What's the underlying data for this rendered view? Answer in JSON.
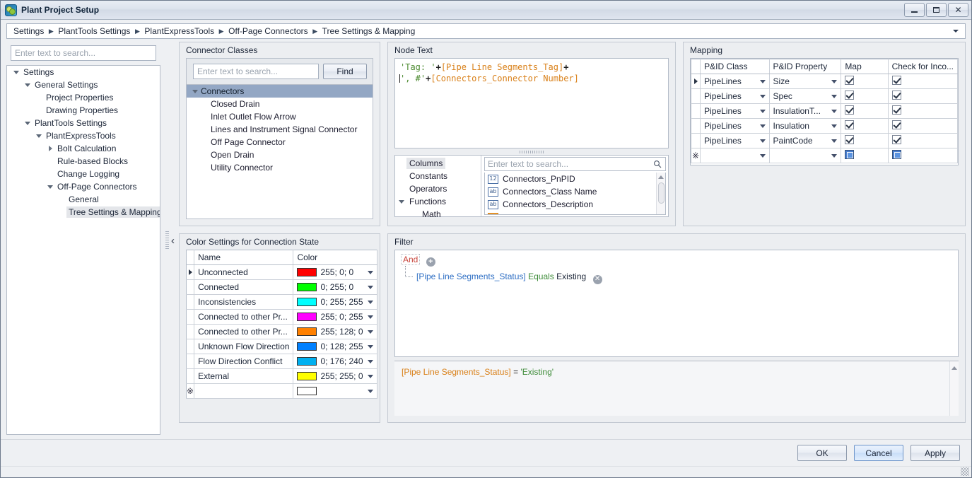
{
  "window": {
    "title": "Plant Project Setup",
    "app_icon": "plant-app-icon",
    "minimize_label": "Minimize",
    "maximize_label": "Maximize",
    "close_label": "Close"
  },
  "breadcrumb": {
    "items": [
      "Settings",
      "PlantTools Settings",
      "PlantExpressTools",
      "Off-Page Connectors",
      "Tree Settings & Mapping"
    ],
    "separator": "▶"
  },
  "sidebar": {
    "search_placeholder": "Enter text to search...",
    "tree": [
      {
        "label": "Settings",
        "depth": 0,
        "twisty": "open",
        "selected": false
      },
      {
        "label": "General Settings",
        "depth": 1,
        "twisty": "open",
        "selected": false
      },
      {
        "label": "Project Properties",
        "depth": 2,
        "twisty": "none",
        "selected": false
      },
      {
        "label": "Drawing Properties",
        "depth": 2,
        "twisty": "none",
        "selected": false
      },
      {
        "label": "PlantTools Settings",
        "depth": 1,
        "twisty": "open",
        "selected": false
      },
      {
        "label": "PlantExpressTools",
        "depth": 2,
        "twisty": "open",
        "selected": false
      },
      {
        "label": "Bolt Calculation",
        "depth": 3,
        "twisty": "closed",
        "selected": false
      },
      {
        "label": "Rule-based Blocks",
        "depth": 3,
        "twisty": "none",
        "selected": false
      },
      {
        "label": "Change Logging",
        "depth": 3,
        "twisty": "none",
        "selected": false
      },
      {
        "label": "Off-Page Connectors",
        "depth": 3,
        "twisty": "open",
        "selected": false
      },
      {
        "label": "General",
        "depth": 4,
        "twisty": "none",
        "selected": false
      },
      {
        "label": "Tree Settings & Mapping",
        "depth": 4,
        "twisty": "none",
        "selected": true
      }
    ],
    "collapse_glyph": "‹"
  },
  "connector_classes": {
    "title": "Connector Classes",
    "search_placeholder": "Enter text to search...",
    "find_label": "Find",
    "root": "Connectors",
    "items": [
      "Closed Drain",
      "Inlet Outlet Flow Arrow",
      "Lines and Instrument Signal Connector",
      "Off Page Connector",
      "Open Drain",
      "Utility Connector"
    ]
  },
  "color_settings": {
    "title": "Color Settings for Connection State",
    "columns": [
      "",
      "Name",
      "Color"
    ],
    "rows": [
      {
        "name": "Unconnected",
        "color_text": "255; 0; 0",
        "swatch": "#ff0000",
        "current": true
      },
      {
        "name": "Connected",
        "color_text": "0; 255; 0",
        "swatch": "#00ff00",
        "current": false
      },
      {
        "name": "Inconsistencies",
        "color_text": "0; 255; 255",
        "swatch": "#00ffff",
        "current": false
      },
      {
        "name": "Connected to other Pr...",
        "color_text": "255; 0; 255",
        "swatch": "#ff00ff",
        "current": false
      },
      {
        "name": "Connected to other Pr...",
        "color_text": "255; 128; 0",
        "swatch": "#ff8000",
        "current": false
      },
      {
        "name": "Unknown Flow Direction",
        "color_text": "0; 128; 255",
        "swatch": "#0080ff",
        "current": false
      },
      {
        "name": "Flow Direction Conflict",
        "color_text": "0; 176; 240",
        "swatch": "#00b0f0",
        "current": false
      },
      {
        "name": "External",
        "color_text": "255; 255; 0",
        "swatch": "#ffff00",
        "current": false
      }
    ],
    "new_row_glyph": "※",
    "new_row_swatch": "#ffffff"
  },
  "node_text": {
    "title": "Node Text",
    "expression_line1_str": "'Tag: '",
    "expression_line1_plus": "+",
    "expression_line1_field": "[Pipe Line Segments_Tag]",
    "expression_line1_tail": "+",
    "expression_line2_str": "', #'",
    "expression_line2_plus": "+",
    "expression_line2_field": "[Connectors_Connector Number]",
    "categories": [
      {
        "label": "Columns",
        "twisty": "none",
        "selected": true,
        "indent": false
      },
      {
        "label": "Constants",
        "twisty": "none",
        "selected": false,
        "indent": false
      },
      {
        "label": "Operators",
        "twisty": "none",
        "selected": false,
        "indent": false
      },
      {
        "label": "Functions",
        "twisty": "open",
        "selected": false,
        "indent": false
      },
      {
        "label": "Math",
        "twisty": "none",
        "selected": false,
        "indent": true
      }
    ],
    "field_search_placeholder": "Enter text to search...",
    "fields": [
      {
        "label": "Connectors_PnPID",
        "type": "12"
      },
      {
        "label": "Connectors_Class Name",
        "type": "ab"
      },
      {
        "label": "Connectors_Description",
        "type": "ab"
      }
    ]
  },
  "mapping": {
    "title": "Mapping",
    "columns": [
      "",
      "P&ID Class",
      "P&ID Property",
      "Map",
      "Check for Inco..."
    ],
    "rows": [
      {
        "pid_class": "PipeLines",
        "pid_property": "Size",
        "map": "checked",
        "check": "checked",
        "current": true
      },
      {
        "pid_class": "PipeLines",
        "pid_property": "Spec",
        "map": "checked",
        "check": "checked",
        "current": false
      },
      {
        "pid_class": "PipeLines",
        "pid_property": "InsulationT...",
        "map": "checked",
        "check": "checked",
        "current": false
      },
      {
        "pid_class": "PipeLines",
        "pid_property": "Insulation",
        "map": "checked",
        "check": "checked",
        "current": false
      },
      {
        "pid_class": "PipeLines",
        "pid_property": "PaintCode",
        "map": "checked",
        "check": "checked",
        "current": false
      }
    ],
    "new_row_glyph": "※"
  },
  "filter": {
    "title": "Filter",
    "group_operator": "And",
    "add_glyph": "+",
    "remove_glyph": "✕",
    "condition_field": "[Pipe Line Segments_Status]",
    "condition_operator": "Equals",
    "condition_value": "Existing",
    "expression_field": "[Pipe Line Segments_Status]",
    "expression_eq": " = ",
    "expression_value": "'Existing'"
  },
  "footer": {
    "ok_label": "OK",
    "cancel_label": "Cancel",
    "apply_label": "Apply"
  }
}
